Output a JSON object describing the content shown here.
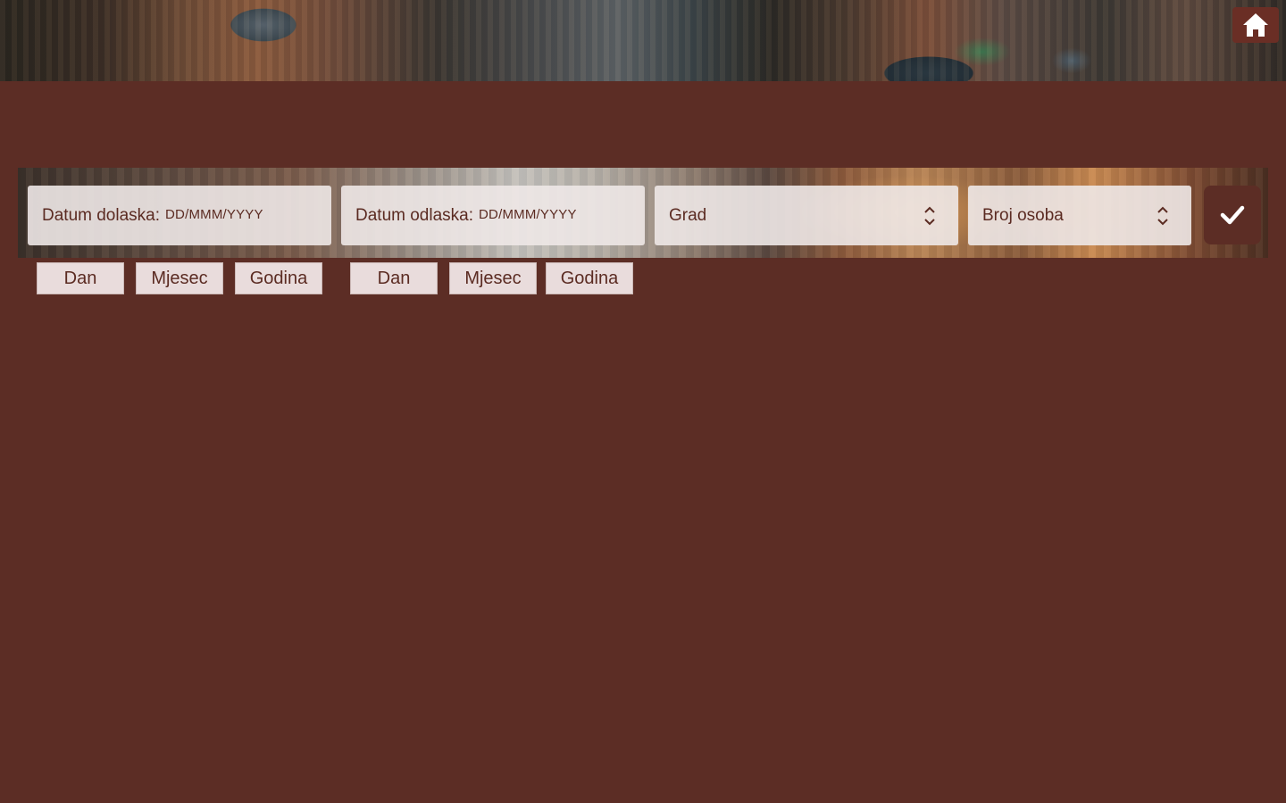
{
  "header": {
    "home_icon": "home-icon"
  },
  "search": {
    "arrival": {
      "label": "Datum dolaska:",
      "placeholder": "DD/MMM/YYYY"
    },
    "departure": {
      "label": "Datum odlaska:",
      "placeholder": "DD/MMM/YYYY"
    },
    "city": {
      "label": "Grad",
      "icon": "updown-chevron-icon"
    },
    "persons": {
      "label": "Broj osoba",
      "icon": "updown-chevron-icon"
    },
    "submit_icon": "checkmark-icon"
  },
  "arrival_parts": [
    "Dan",
    "Mjesec",
    "Godina"
  ],
  "departure_parts": [
    "Dan",
    "Mjesec",
    "Godina"
  ],
  "colors": {
    "background": "#5c2d25",
    "text": "#5b2b22",
    "field_bg": "#eee8e7",
    "chip_bg": "#e9dcdc"
  }
}
